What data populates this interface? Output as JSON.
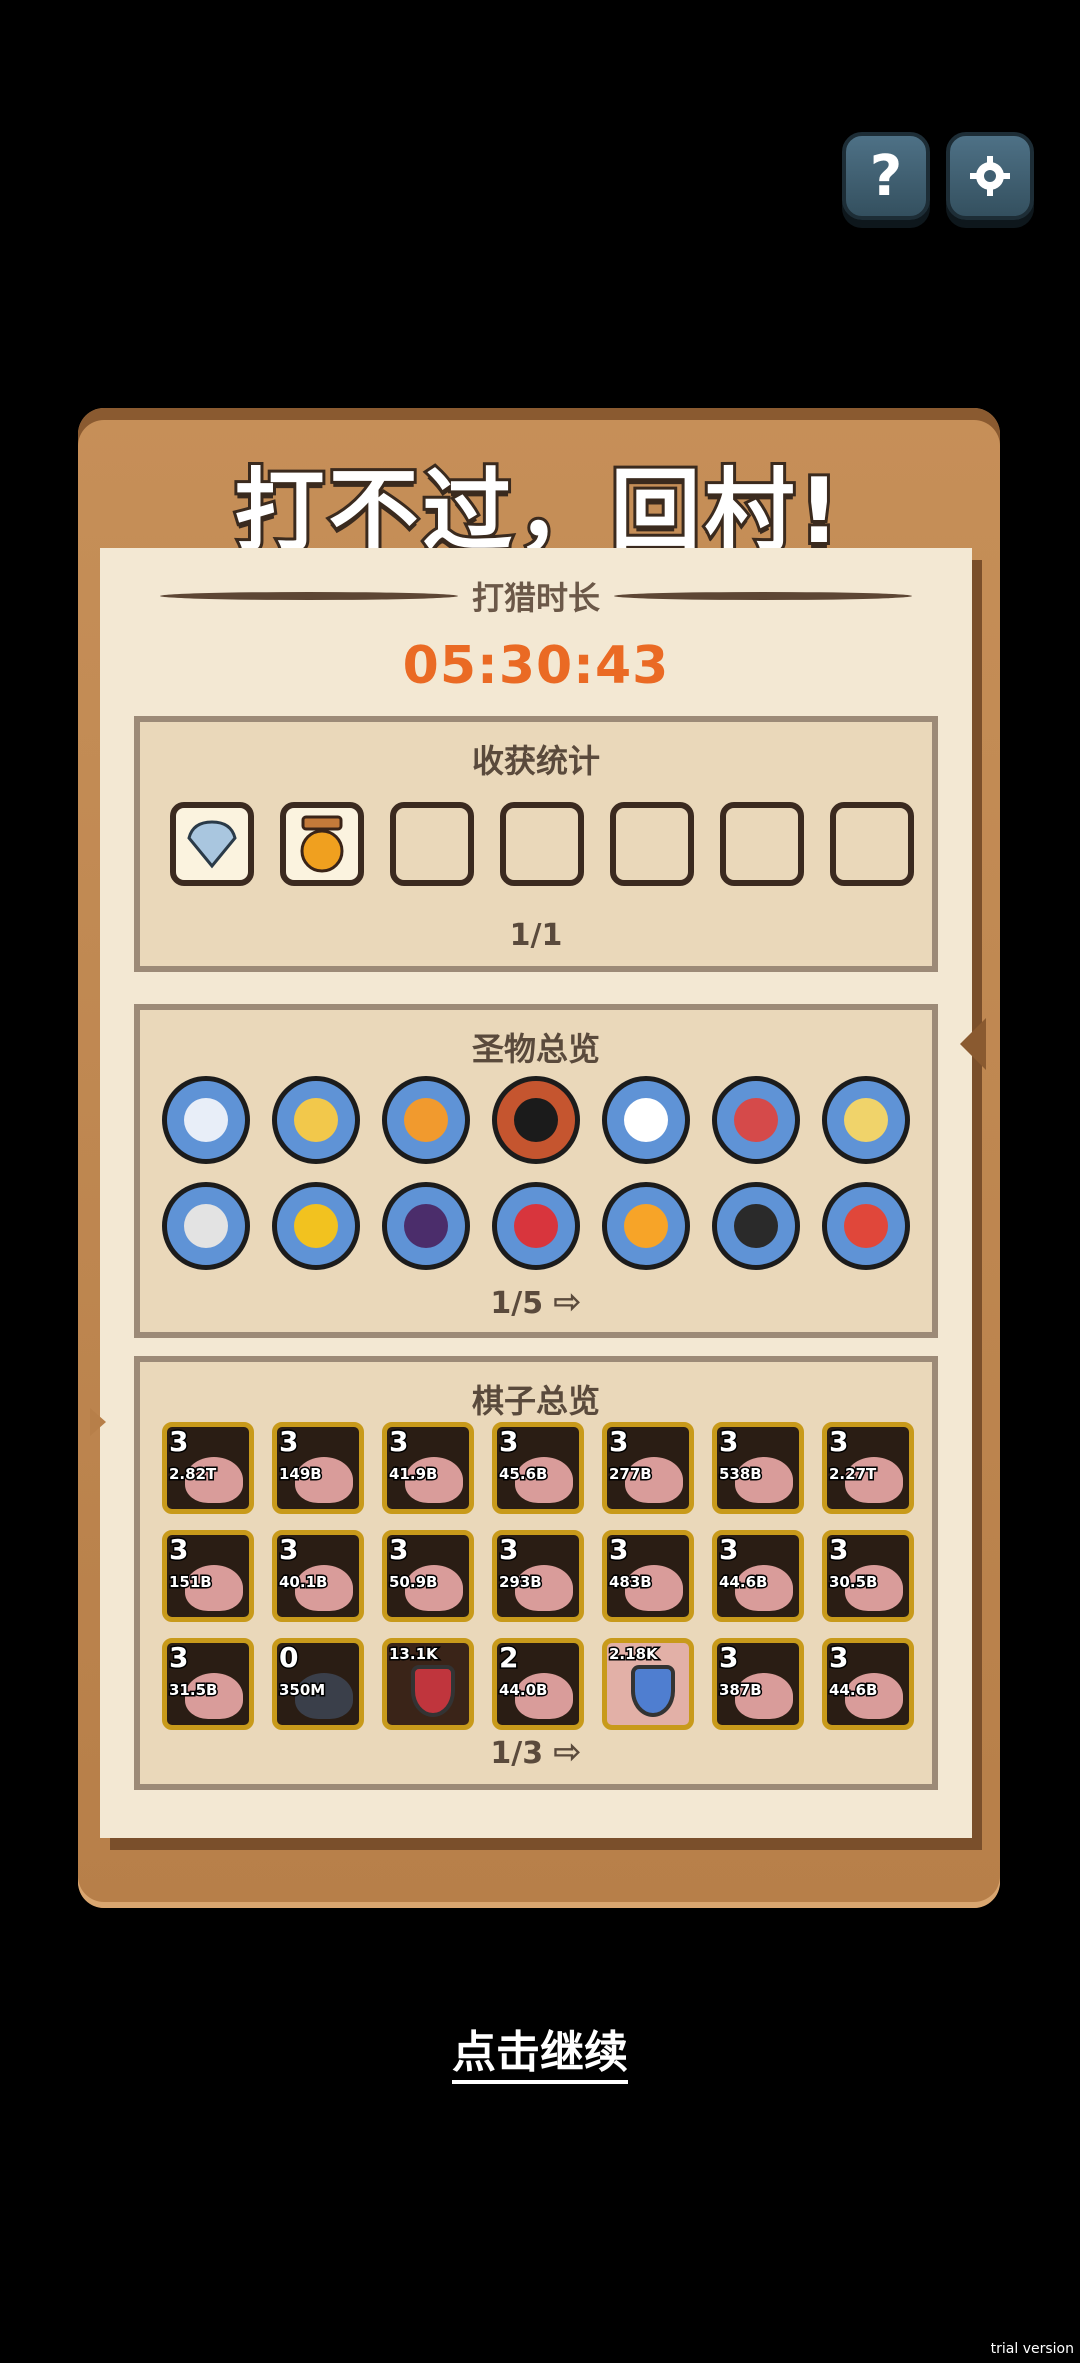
{
  "header": {
    "help_icon": "question-icon",
    "settings_icon": "gear-icon"
  },
  "board": {
    "title": "打不过，回村!",
    "hunt_label": "打猎时长",
    "hunt_time": "05:30:43"
  },
  "harvest": {
    "title": "收获统计",
    "items": [
      "shell-icon",
      "honey-jar-icon",
      "",
      "",
      "",
      "",
      ""
    ],
    "pager": "1/1"
  },
  "relics": {
    "title": "圣物总览",
    "pager": "1/5",
    "icons": [
      "crab-icon",
      "compass-icon",
      "flame-icon",
      "skull-mage-icon",
      "rain-cloud-icon",
      "magic-book-icon",
      "cards-icon",
      "helmet-icon",
      "gold-orb-icon",
      "cauldron-icon",
      "potion-icon",
      "fire-orb-icon",
      "ninja-icon",
      "totem-icon"
    ]
  },
  "pieces": {
    "title": "棋子总览",
    "pager": "1/3",
    "items": [
      {
        "level": "3",
        "value": "2.82T",
        "kind": "pig"
      },
      {
        "level": "3",
        "value": "149B",
        "kind": "pig"
      },
      {
        "level": "3",
        "value": "41.9B",
        "kind": "pig"
      },
      {
        "level": "3",
        "value": "45.6B",
        "kind": "pig"
      },
      {
        "level": "3",
        "value": "277B",
        "kind": "pig"
      },
      {
        "level": "3",
        "value": "538B",
        "kind": "pig"
      },
      {
        "level": "3",
        "value": "2.27T",
        "kind": "pig"
      },
      {
        "level": "3",
        "value": "151B",
        "kind": "pig"
      },
      {
        "level": "3",
        "value": "40.1B",
        "kind": "pig"
      },
      {
        "level": "3",
        "value": "50.9B",
        "kind": "pig"
      },
      {
        "level": "3",
        "value": "293B",
        "kind": "pig"
      },
      {
        "level": "3",
        "value": "483B",
        "kind": "pig"
      },
      {
        "level": "3",
        "value": "44.6B",
        "kind": "pig"
      },
      {
        "level": "3",
        "value": "30.5B",
        "kind": "pig"
      },
      {
        "level": "3",
        "value": "31.5B",
        "kind": "pig"
      },
      {
        "level": "0",
        "value": "350M",
        "kind": "ninja"
      },
      {
        "level": "",
        "value": "13.1K",
        "kind": "shield-red"
      },
      {
        "level": "2",
        "value": "44.0B",
        "kind": "pig"
      },
      {
        "level": "",
        "value": "2.18K",
        "kind": "shield-blue"
      },
      {
        "level": "3",
        "value": "387B",
        "kind": "pig"
      },
      {
        "level": "3",
        "value": "44.6B",
        "kind": "pig"
      }
    ]
  },
  "footer": {
    "continue_label": "点击继续",
    "watermark": "trial version"
  },
  "colors": {
    "timer": "#ea6a24",
    "board": "#c68f58",
    "paper": "#f3e8d3"
  }
}
